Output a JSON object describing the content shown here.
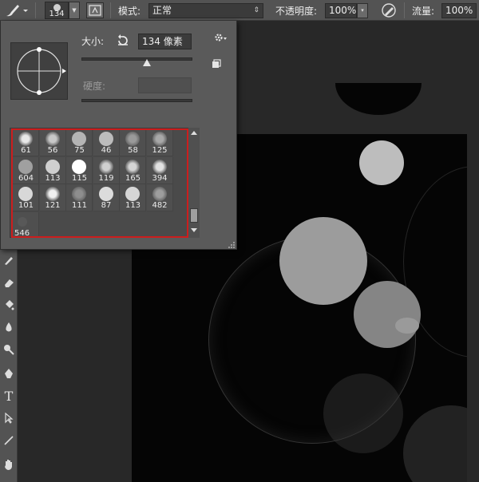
{
  "toolbar_options": {
    "brush_size_value": "134",
    "mode_label": "模式:",
    "mode_value": "正常",
    "opacity_label": "不透明度:",
    "opacity_value": "100%",
    "flow_label": "流量:",
    "flow_value": "100%"
  },
  "brush_panel": {
    "size_label": "大小:",
    "size_value": "134 像素",
    "hardness_label": "硬度:",
    "hardness_value": "",
    "presets": [
      {
        "size": "61",
        "tone": "#e8e8e8",
        "soft": true
      },
      {
        "size": "56",
        "tone": "#c8c8c8",
        "soft": true
      },
      {
        "size": "75",
        "tone": "#b4b4b4",
        "soft": false
      },
      {
        "size": "46",
        "tone": "#bcbcbc",
        "soft": false
      },
      {
        "size": "58",
        "tone": "#9a9a9a",
        "soft": true
      },
      {
        "size": "125",
        "tone": "#a8a8a8",
        "soft": true
      },
      {
        "size": "604",
        "tone": "#a0a0a0",
        "soft": false
      },
      {
        "size": "113",
        "tone": "#cfcfcf",
        "soft": false
      },
      {
        "size": "115",
        "tone": "#ffffff",
        "soft": false
      },
      {
        "size": "119",
        "tone": "#d0d0d0",
        "soft": true
      },
      {
        "size": "165",
        "tone": "#d5d5d5",
        "soft": true
      },
      {
        "size": "394",
        "tone": "#e2e2e2",
        "soft": true
      },
      {
        "size": "101",
        "tone": "#d8d8d8",
        "soft": false
      },
      {
        "size": "121",
        "tone": "#f0f0f0",
        "soft": true
      },
      {
        "size": "111",
        "tone": "#8e8e8e",
        "soft": true
      },
      {
        "size": "87",
        "tone": "#dcdcdc",
        "soft": false
      },
      {
        "size": "113",
        "tone": "#d6d6d6",
        "soft": false
      },
      {
        "size": "482",
        "tone": "#9e9e9e",
        "soft": true
      },
      {
        "size": "546",
        "tone": "#585858",
        "soft": false
      }
    ]
  },
  "colors": {
    "highlight_border": "#cc1d1d",
    "panel_bg": "#5a5a5a",
    "ui_bg": "#535353",
    "canvas_bg": "#050505"
  }
}
